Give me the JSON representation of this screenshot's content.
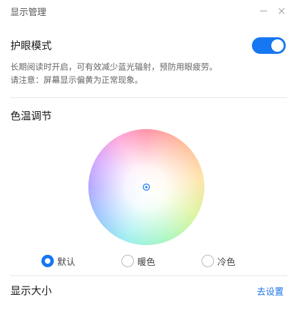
{
  "window": {
    "title": "显示管理",
    "minimize_glyph": "—",
    "close_glyph": "✕"
  },
  "eye_mode": {
    "title": "护眼模式",
    "enabled": true,
    "description_line1": "长期阅读时开启，可有效减少蓝光辐射，预防用眼疲劳。",
    "description_line2": "请注意：屏幕显示偏黄为正常现象。"
  },
  "color_temp": {
    "title": "色温调节",
    "picker_icon": "crosshair-target-icon",
    "options": [
      {
        "label": "默认",
        "checked": true
      },
      {
        "label": "暖色",
        "checked": false
      },
      {
        "label": "冷色",
        "checked": false
      }
    ]
  },
  "display_size": {
    "title": "显示大小",
    "link_label": "去设置"
  },
  "colors": {
    "accent": "#1677f2",
    "link": "#1a73e8"
  }
}
